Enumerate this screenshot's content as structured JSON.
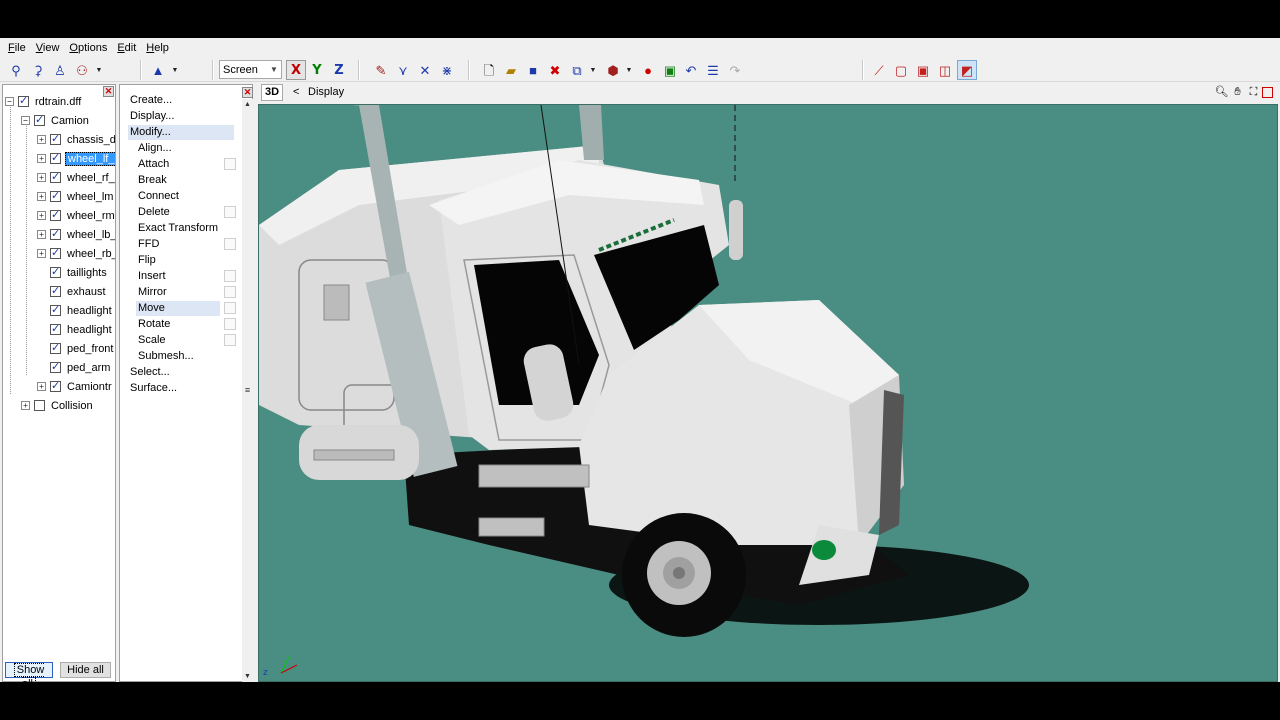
{
  "menu": [
    {
      "label": "File",
      "u": "F",
      "rest": "ile"
    },
    {
      "label": "View",
      "u": "V",
      "rest": "iew"
    },
    {
      "label": "Options",
      "u": "O",
      "rest": "ptions"
    },
    {
      "label": "Edit",
      "u": "E",
      "rest": "dit"
    },
    {
      "label": "Help",
      "u": "H",
      "rest": "elp"
    }
  ],
  "toolbar": {
    "coord_space": "Screen",
    "axes": [
      "X",
      "Y",
      "Z"
    ],
    "axis_colors": {
      "X": "#c00000",
      "Y": "#008000",
      "Z": "#1c3aa9"
    }
  },
  "tree": {
    "items": [
      {
        "label": "rdtrain.dff",
        "checked": true,
        "expander": "−",
        "level": 0
      },
      {
        "label": "Camion",
        "checked": true,
        "expander": "−",
        "level": 1
      },
      {
        "label": "chassis_d",
        "checked": true,
        "expander": "+",
        "level": 2
      },
      {
        "label": "wheel_lf_",
        "checked": true,
        "expander": "+",
        "level": 2,
        "selected": true
      },
      {
        "label": "wheel_rf_",
        "checked": true,
        "expander": "+",
        "level": 2
      },
      {
        "label": "wheel_lm",
        "checked": true,
        "expander": "+",
        "level": 2
      },
      {
        "label": "wheel_rm",
        "checked": true,
        "expander": "+",
        "level": 2
      },
      {
        "label": "wheel_lb_",
        "checked": true,
        "expander": "+",
        "level": 2
      },
      {
        "label": "wheel_rb_",
        "checked": true,
        "expander": "+",
        "level": 2
      },
      {
        "label": "taillights",
        "checked": true,
        "expander": "",
        "level": 2
      },
      {
        "label": "exhaust",
        "checked": true,
        "expander": "",
        "level": 2
      },
      {
        "label": "headlight",
        "checked": true,
        "expander": "",
        "level": 2
      },
      {
        "label": "headlight",
        "checked": true,
        "expander": "",
        "level": 2
      },
      {
        "label": "ped_front",
        "checked": true,
        "expander": "",
        "level": 2
      },
      {
        "label": "ped_arm",
        "checked": true,
        "expander": "",
        "level": 2
      },
      {
        "label": "Camiontr",
        "checked": true,
        "expander": "+",
        "level": 2
      },
      {
        "label": "Collision",
        "checked": false,
        "expander": "+",
        "level": 1
      }
    ],
    "show_all": "Show all",
    "hide_all": "Hide all"
  },
  "commands": {
    "items": [
      {
        "label": "Create...",
        "indent": 0
      },
      {
        "label": "Display...",
        "indent": 0
      },
      {
        "label": "Modify...",
        "indent": 0,
        "highlight": true
      },
      {
        "label": "Align...",
        "indent": 1
      },
      {
        "label": "Attach",
        "indent": 1,
        "box": true
      },
      {
        "label": "Break",
        "indent": 1
      },
      {
        "label": "Connect",
        "indent": 1
      },
      {
        "label": "Delete",
        "indent": 1,
        "box": true
      },
      {
        "label": "Exact Transform",
        "indent": 1
      },
      {
        "label": "FFD",
        "indent": 1,
        "box": true
      },
      {
        "label": "Flip",
        "indent": 1
      },
      {
        "label": "Insert",
        "indent": 1,
        "box": true
      },
      {
        "label": "Mirror",
        "indent": 1,
        "box": true
      },
      {
        "label": "Move",
        "indent": 1,
        "box": true,
        "highlight": true
      },
      {
        "label": "Rotate",
        "indent": 1,
        "box": true
      },
      {
        "label": "Scale",
        "indent": 1,
        "box": true
      },
      {
        "label": "Submesh...",
        "indent": 1
      },
      {
        "label": "Select...",
        "indent": 0
      },
      {
        "label": "Surface...",
        "indent": 0
      }
    ]
  },
  "viewport": {
    "mode": "3D",
    "back": "<",
    "title": "Display",
    "background": "#4a8d82"
  }
}
